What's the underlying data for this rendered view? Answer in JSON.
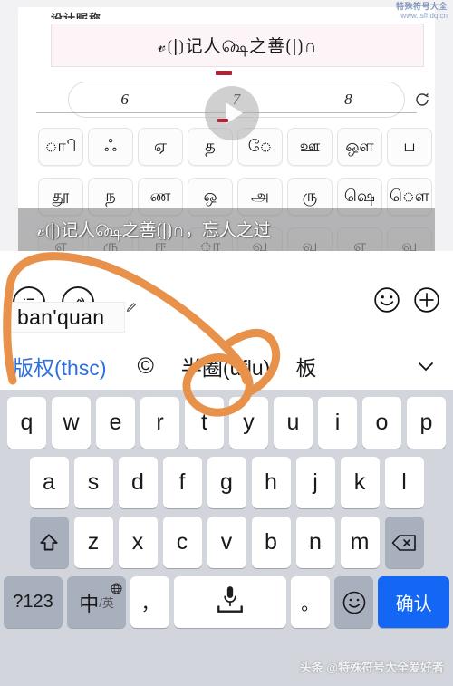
{
  "watermarks": {
    "top_line1": "特殊符号大全",
    "top_line2": "www.tsfhdq.cn",
    "bottom": "头条 @特殊符号大全爱好者"
  },
  "video": {
    "field_label": "设计昵称",
    "nickname_text": "𝓋⟮|⟯记人௸之善⟮|⟯∩",
    "number_options": [
      "6",
      "7",
      "8"
    ],
    "refresh_icon": "refresh-icon",
    "play_icon": "play-icon",
    "subtitle": "𝓋⟮|⟯记人௸之善⟮|⟯∩，忘人之过",
    "symbol_rows": [
      [
        "ாி",
        "ஃ",
        "ஏ",
        "த",
        "ே",
        "ஊ",
        "ஒள",
        "ப"
      ],
      [
        "தூ",
        "ந",
        "ண",
        "ஒ",
        "அ",
        "ரு",
        "ஷெ",
        "ௌ"
      ],
      [
        "எ",
        "ரு",
        "ஈ",
        "ா",
        "வ",
        "வ",
        "எ",
        "வ"
      ]
    ]
  },
  "ime": {
    "icons_left": [
      "list-icon",
      "voice-icon"
    ],
    "icons_right": [
      "emoji-icon",
      "plus-icon"
    ],
    "pinyin_value": "ban'quan",
    "pinyin_placeholder": "",
    "edit_icon": "pencil-icon",
    "candidates": [
      {
        "label": "版权(thsc)",
        "primary": true
      },
      {
        "label": "©",
        "primary": false
      },
      {
        "label": "半圈(uflu)",
        "primary": false
      },
      {
        "label": "板",
        "primary": false
      }
    ],
    "expand_icon": "chevron-down-icon",
    "accent_color": "#2f6fdd"
  },
  "keyboard": {
    "row1": [
      "q",
      "w",
      "e",
      "r",
      "t",
      "y",
      "u",
      "i",
      "o",
      "p"
    ],
    "row2": [
      "a",
      "s",
      "d",
      "f",
      "g",
      "h",
      "j",
      "k",
      "l"
    ],
    "row3_letters": [
      "z",
      "x",
      "c",
      "v",
      "b",
      "n",
      "m"
    ],
    "shift_icon": "shift-icon",
    "backspace_icon": "backspace-icon",
    "numbers_key": "?123",
    "lang_main": "中",
    "lang_sub": "/英",
    "globe_icon": "globe-icon",
    "comma_key": "，",
    "space_icon": "microphone-icon",
    "period_key": "。",
    "emoji_key_icon": "smiley-icon",
    "enter_key": "确认",
    "enter_color": "#1466f5"
  },
  "annotation": {
    "color": "#e8914a",
    "shape": "hand-drawn-circle-highlight"
  }
}
